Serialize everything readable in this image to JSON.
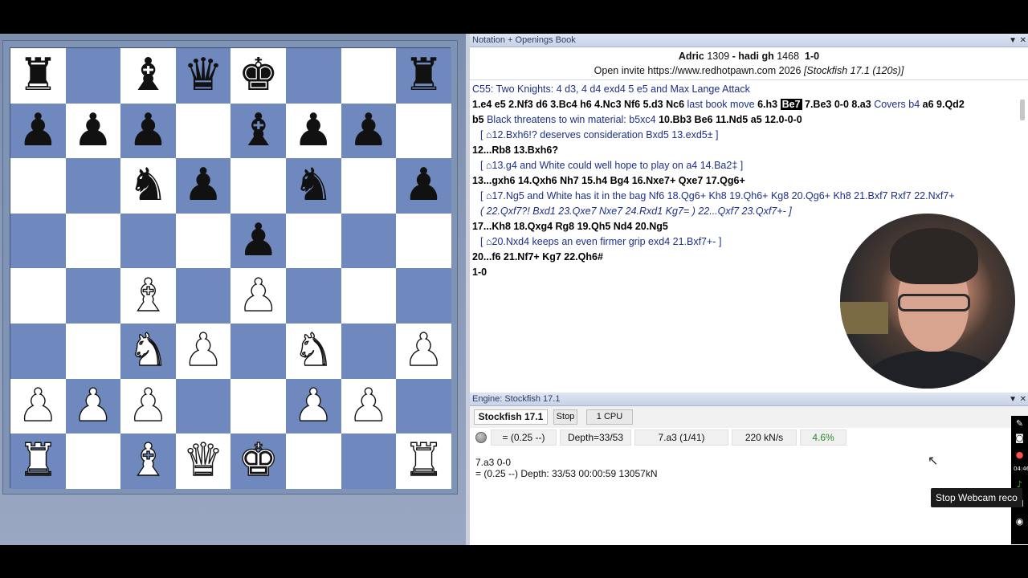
{
  "board": {
    "rows": [
      [
        "r",
        "",
        "b",
        "q",
        "k",
        "",
        "",
        "r"
      ],
      [
        "p",
        "p",
        "p",
        "",
        "b",
        "p",
        "p",
        ""
      ],
      [
        "",
        "",
        "n",
        "p",
        "",
        "n",
        "",
        "p"
      ],
      [
        "",
        "",
        "",
        "",
        "p",
        "",
        "",
        ""
      ],
      [
        "",
        "",
        "B",
        "",
        "P",
        "",
        "",
        ""
      ],
      [
        "",
        "",
        "N",
        "P",
        "",
        "N",
        "",
        "P"
      ],
      [
        "P",
        "P",
        "P",
        "",
        "",
        "P",
        "P",
        ""
      ],
      [
        "R",
        "",
        "B",
        "Q",
        "K",
        "",
        "",
        "R"
      ]
    ]
  },
  "notation": {
    "pane_title": "Notation + Openings Book",
    "players": {
      "white": "Adric",
      "white_elo": "1309",
      "sep": "-",
      "black": "hadi gh",
      "black_elo": "1468",
      "result": "1-0"
    },
    "event": "Open invite https://www.redhotpawn.com 2026",
    "engine_tag": "[Stockfish 17.1 (120s)]",
    "opening": "C55: Two Knights: 4 d3, 4 d4 exd4 5 e5 and Max Lange Attack",
    "line1": {
      "a": "1.e4  e5  2.Nf3  d6  3.Bc4  h6  4.Nc3  Nf6  5.d3  Nc6",
      "b": "last book move",
      "c": "6.h3",
      "cur": "Be7",
      "d": "7.Be3  0-0  8.a3",
      "e": "Covers b4",
      "f": "a6  9.Qd2"
    },
    "line2": {
      "a": "b5",
      "b": "Black threatens to win material: b5xc4",
      "c": "10.Bb3  Be6  11.Nd5  a5  12.0-0-0"
    },
    "var1": "[ ⌂12.Bxh6!? deserves consideration  Bxd5  13.exd5± ]",
    "line3": "12...Rb8  13.Bxh6?",
    "var2": "[ ⌂13.g4 and White could well hope to play on  a4  14.Ba2‡ ]",
    "line4": "13...gxh6  14.Qxh6  Nh7  15.h4  Bg4  16.Nxe7+  Qxe7  17.Qg6+",
    "var3": "[ ⌂17.Ng5 and White has it in the bag  Nf6  18.Qg6+  Kh8  19.Qh6+  Kg8  20.Qg6+  Kh8  21.Bxf7  Rxf7  22.Nxf7+",
    "var3b": "( 22.Qxf7?!  Bxd1  23.Qxe7  Nxe7  24.Rxd1  Kg7= ) 22...Qxf7  23.Qxf7+- ]",
    "line5": "17...Kh8  18.Qxg4  Rg8  19.Qh5  Nd4  20.Ng5",
    "var4": "[ ⌂20.Nxd4 keeps an even firmer grip  exd4  21.Bxf7+- ]",
    "line6": "20...f6  21.Nf7+  Kg7  22.Qh6#",
    "result_line": "1-0"
  },
  "engine": {
    "pane_title": "Engine: Stockfish 17.1",
    "name": "Stockfish 17.1",
    "stop": "Stop",
    "cpu": "1 CPU",
    "eval": "=   (0.25 --)",
    "depth": "Depth=33/53",
    "move": "7.a3 (1/41)",
    "speed": "220 kN/s",
    "percent": "4.6%",
    "pv_line1": "7.a3 0-0",
    "pv_line2": "=  (0.25 --)    Depth: 33/53    00:00:59   13057kN"
  },
  "overlay": {
    "tooltip": "Stop Webcam reco",
    "time": "04:46"
  },
  "colors": {
    "dark_square": "#6f89bf",
    "light_square": "#ffffff",
    "accent": "#1d2f8a"
  }
}
